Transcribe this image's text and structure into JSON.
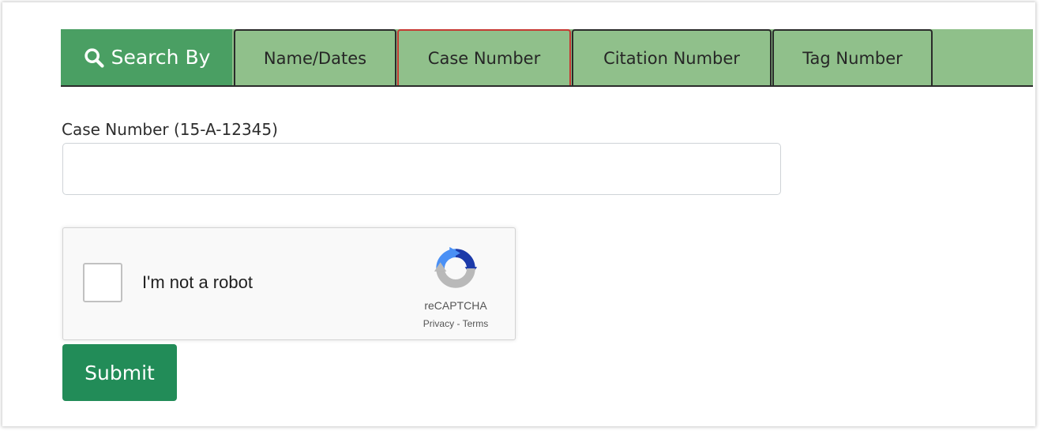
{
  "tabs": {
    "search_by_label": "Search By",
    "items": [
      {
        "label": "Name/Dates",
        "active": false
      },
      {
        "label": "Case Number",
        "active": true
      },
      {
        "label": "Citation Number",
        "active": false
      },
      {
        "label": "Tag Number",
        "active": false
      }
    ]
  },
  "form": {
    "case_number_label": "Case Number (15-A-12345)",
    "case_number_value": ""
  },
  "recaptcha": {
    "checkbox_label": "I'm not a robot",
    "brand": "reCAPTCHA",
    "privacy_link": "Privacy",
    "separator": " - ",
    "terms_link": "Terms",
    "checked": false
  },
  "submit_label": "Submit",
  "colors": {
    "tab_bar": "#8fc08a",
    "search_by_bg": "#4a9f63",
    "active_tab_border": "#c63a33",
    "submit_bg": "#228c58"
  },
  "icons": {
    "search_by": "search-icon",
    "recaptcha_logo": "recaptcha-logo-icon"
  }
}
